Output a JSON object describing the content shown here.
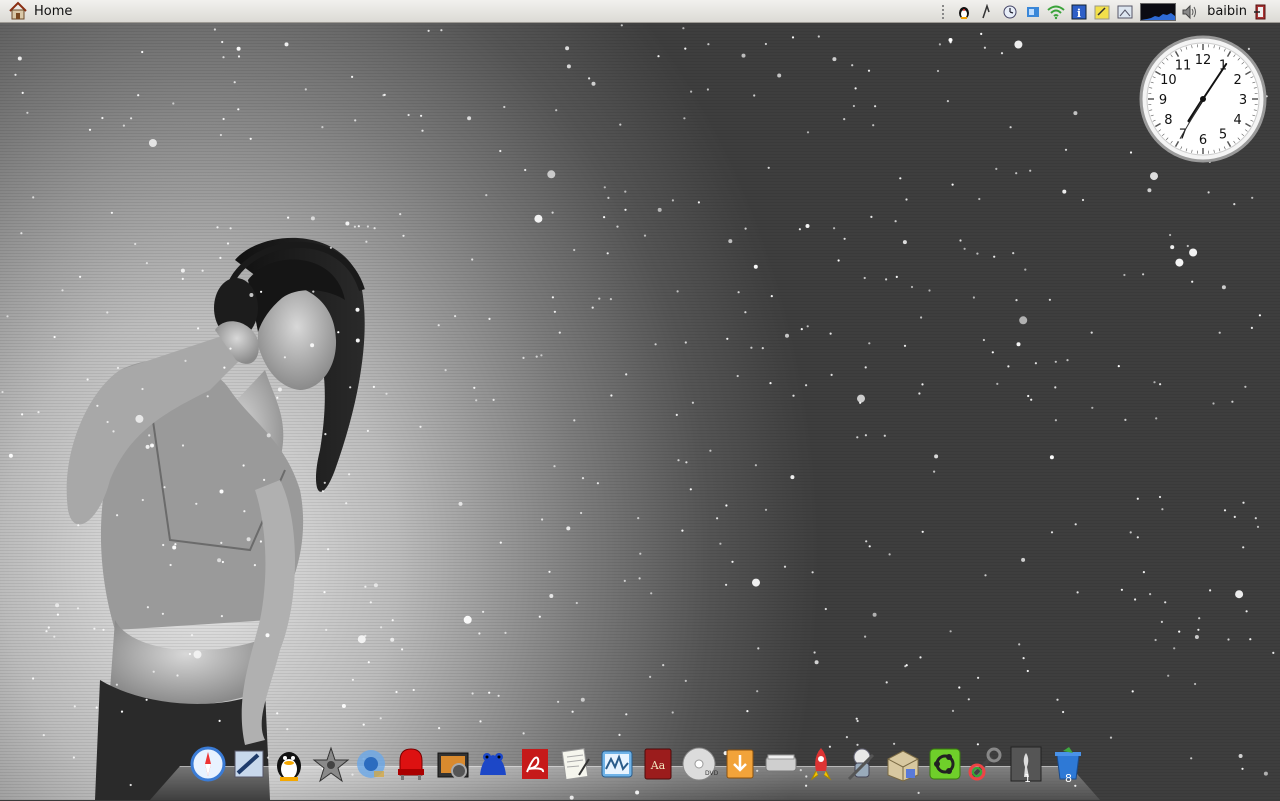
{
  "panel": {
    "home_label": "Home",
    "user_name": "baibin",
    "tray_icons": [
      "qq-penguin-icon",
      "network-tool-icon",
      "clock-applet-icon",
      "window-list-icon",
      "wifi-icon",
      "info-icon",
      "notes-icon",
      "screenshot-icon",
      "system-monitor-icon",
      "volume-icon",
      "logout-icon"
    ]
  },
  "clock": {
    "numerals": [
      "12",
      "1",
      "2",
      "3",
      "4",
      "5",
      "6",
      "7",
      "8",
      "9",
      "10",
      "11"
    ],
    "hour": 7,
    "minute": 5,
    "second": 35
  },
  "dock": {
    "items": [
      {
        "name": "safari-icon"
      },
      {
        "name": "mail-icon"
      },
      {
        "name": "qq-icon"
      },
      {
        "name": "imovie-icon"
      },
      {
        "name": "quicktime-icon"
      },
      {
        "name": "front-row-icon"
      },
      {
        "name": "photo-booth-icon"
      },
      {
        "name": "frog-app-icon"
      },
      {
        "name": "acrobat-reader-icon"
      },
      {
        "name": "text-editor-icon"
      },
      {
        "name": "activity-monitor-icon"
      },
      {
        "name": "dictionary-icon"
      },
      {
        "name": "dvd-player-icon"
      },
      {
        "name": "app-installer-icon"
      },
      {
        "name": "scanner-icon"
      },
      {
        "name": "rocket-icon"
      },
      {
        "name": "automator-icon"
      },
      {
        "name": "package-icon"
      },
      {
        "name": "ubuntu-icon"
      },
      {
        "name": "system-settings-icon"
      },
      {
        "name": "workspace-switcher-icon"
      },
      {
        "name": "trash-icon"
      }
    ],
    "workspace_badge": "1",
    "trash_badge": "8"
  }
}
